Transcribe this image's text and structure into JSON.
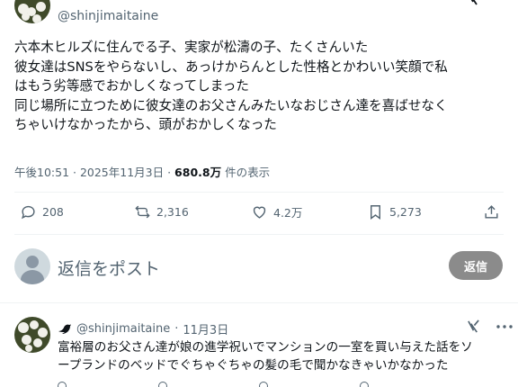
{
  "main_post": {
    "handle": "@shinjimaitaine",
    "lines": [
      "六本木ヒルズに住んでる子、実家が松濤の子、たくさんいた",
      "彼女達はSNSをやらないし、あっけからんとした性格とかわいい笑顔で私",
      "はもう劣等感でおかしくなってしまった",
      "同じ場所に立つために彼女達のお父さんみたいなおじさん達を喜ばせなく",
      "ちゃいけなかったから、頭がおかしくなった"
    ],
    "meta": {
      "timestamp": "午後10:51 · 2025年11月3日 · ",
      "views_count": "680.8万",
      "views_label": " 件の表示"
    },
    "actions": {
      "reply_count": "208",
      "repost_count": "2,316",
      "like_count": "4.2万",
      "bookmark_count": "5,273"
    }
  },
  "reply_composer": {
    "placeholder": "返信をポスト",
    "button_label": "返信"
  },
  "second_post": {
    "handle": "@shinjimaitaine",
    "separator": "·",
    "date": "11月3日",
    "lines": [
      "富裕層のお父さん達が娘の進学祝いでマンションの一室を買い与えた話をソ",
      "ープランドのベッドでぐちゃぐちゃの髪の毛で聞かなきゃいかなかった"
    ]
  },
  "icons": {
    "reply": "speech-bubble-icon",
    "repost": "repost-arrows-icon",
    "like": "heart-icon",
    "bookmark": "bookmark-icon",
    "share": "share-upload-icon",
    "grok": "grok-icon",
    "more": "more-dots-icon",
    "bird": "bird-icon"
  }
}
